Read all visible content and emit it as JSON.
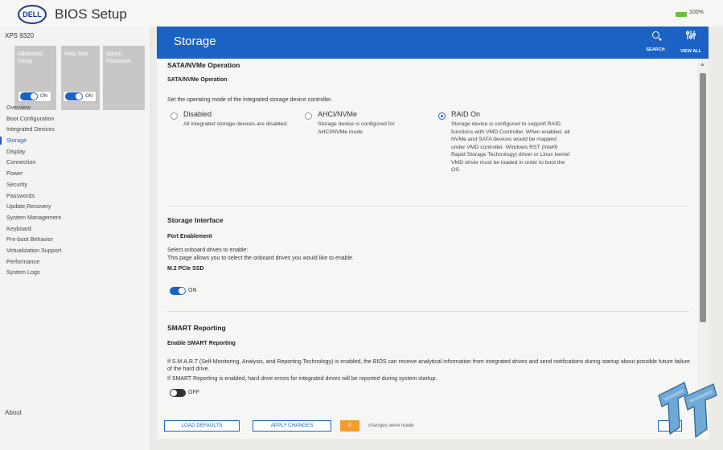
{
  "app": {
    "logo_text": "DELL",
    "title": "BIOS Setup",
    "battery": "100%"
  },
  "sidebar": {
    "model": "XPS 9320",
    "tiles": [
      {
        "label": "Advanced Setup",
        "toggle": "ON"
      },
      {
        "label": "Help Text",
        "toggle": "ON"
      },
      {
        "label": "Admin Password"
      }
    ],
    "items": [
      {
        "label": "Overview"
      },
      {
        "label": "Boot Configuration"
      },
      {
        "label": "Integrated Devices"
      },
      {
        "label": "Storage",
        "active": true
      },
      {
        "label": "Display"
      },
      {
        "label": "Connection"
      },
      {
        "label": "Power"
      },
      {
        "label": "Security"
      },
      {
        "label": "Passwords"
      },
      {
        "label": "Update,Recovery"
      },
      {
        "label": "System Management"
      },
      {
        "label": "Keyboard"
      },
      {
        "label": "Pre-boot Behavior"
      },
      {
        "label": "Virtualization Support"
      },
      {
        "label": "Performance"
      },
      {
        "label": "System Logs"
      }
    ],
    "about": "About"
  },
  "header": {
    "title": "Storage",
    "search_label": "SEARCH",
    "view_all_label": "VIEW ALL"
  },
  "sata": {
    "section_title": "SATA/NVMe Operation",
    "subtitle": "SATA/NVMe Operation",
    "description": "Set the operating mode of the integrated storage device controller.",
    "options": [
      {
        "title": "Disabled",
        "desc": "All integrated storage devices are disabled.",
        "checked": false
      },
      {
        "title": "AHCI/NVMe",
        "desc": "Storage device is configured for AHCI/NVMe mode",
        "checked": false
      },
      {
        "title": "RAID On",
        "desc": "Storage device is configured to support RAID functions with VMD Controller. When enabled, all NVMe and SATA devices would be mapped under VMD controller. Windows RST (Intel® Rapid Storage Technology) driver or Linux kernel VMD driver must be loaded in order to boot the OS.",
        "checked": true
      }
    ]
  },
  "storage_interface": {
    "section_title": "Storage Interface",
    "subtitle": "Port Enablement",
    "line1": "Select onboard drives to enable:",
    "line2": "This page allows you to select the onboard drives you would like to enable.",
    "drive_label": "M.2 PCIe SSD",
    "toggle": "ON"
  },
  "smart": {
    "section_title": "SMART Reporting",
    "subtitle": "Enable SMART Reporting",
    "desc1": "If S.M.A.R.T (Self-Monitoring, Analysis, and Reporting Technology) is enabled, the BIOS can receive analytical information from integrated drives and send notifications during startup about possible future failure of the hard drive.",
    "desc2": "If SMART Reporting is enabled, hard drive errors for integrated drives will be reported during system startup.",
    "toggle": "OFF"
  },
  "footer": {
    "load_defaults": "LOAD DEFAULTS",
    "apply_changes": "APPLY CHANGES",
    "changes_count": "0",
    "changes_text": "changes were made"
  },
  "colors": {
    "accent": "#1c62c4",
    "badge": "#f29e2f"
  }
}
